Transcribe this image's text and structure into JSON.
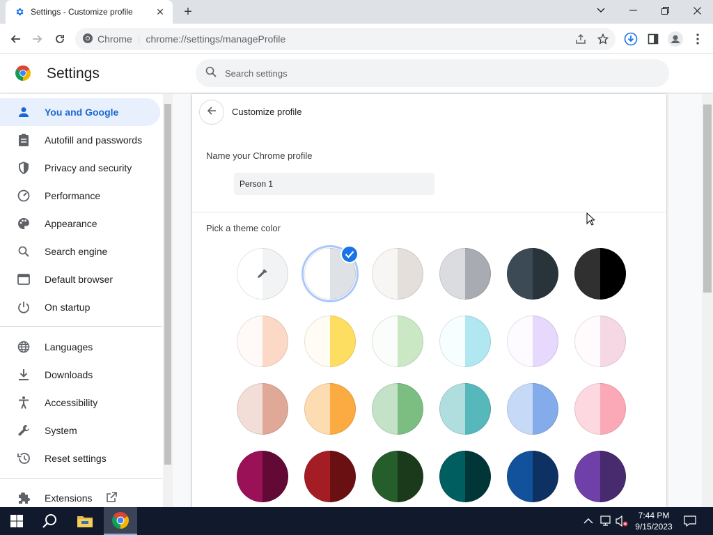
{
  "browser": {
    "tab_title": "Settings - Customize profile",
    "omnibox_site": "Chrome",
    "omnibox_url": "chrome://settings/manageProfile"
  },
  "settings_header": {
    "title": "Settings",
    "search_placeholder": "Search settings"
  },
  "sidebar": {
    "items": [
      {
        "label": "You and Google",
        "icon": "person-icon",
        "active": true
      },
      {
        "label": "Autofill and passwords",
        "icon": "clipboard-icon"
      },
      {
        "label": "Privacy and security",
        "icon": "shield-icon"
      },
      {
        "label": "Performance",
        "icon": "speedometer-icon"
      },
      {
        "label": "Appearance",
        "icon": "palette-icon"
      },
      {
        "label": "Search engine",
        "icon": "search-icon"
      },
      {
        "label": "Default browser",
        "icon": "browser-window-icon"
      },
      {
        "label": "On startup",
        "icon": "power-icon"
      },
      {
        "label": "Languages",
        "icon": "globe-icon"
      },
      {
        "label": "Downloads",
        "icon": "download-icon"
      },
      {
        "label": "Accessibility",
        "icon": "accessibility-icon"
      },
      {
        "label": "System",
        "icon": "wrench-icon"
      },
      {
        "label": "Reset settings",
        "icon": "history-icon"
      },
      {
        "label": "Extensions",
        "icon": "puzzle-icon"
      }
    ]
  },
  "main": {
    "page_title": "Customize profile",
    "name_label": "Name your Chrome profile",
    "name_value": "Person 1",
    "theme_label": "Pick a theme color",
    "selected_theme_index": 1,
    "theme_colors": [
      [
        "#ffffff",
        "#f1f3f4"
      ],
      [
        "#ffffff",
        "#dee1e6"
      ],
      [
        "#f8f6f5",
        "#e4dfdb"
      ],
      [
        "#dadce0",
        "#a9abb3"
      ],
      [
        "#3c4a55",
        "#28343a"
      ],
      [
        "#303030",
        "#000000"
      ],
      [
        "#fffaf7",
        "#fcd8c6"
      ],
      [
        "#fffdf3",
        "#fede60"
      ],
      [
        "#fafdf9",
        "#cbe8c5"
      ],
      [
        "#f7feff",
        "#b0e7f1"
      ],
      [
        "#fdfbff",
        "#e7d8fd"
      ],
      [
        "#fffbfd",
        "#f5d8e4"
      ],
      [
        "#f3ddd7",
        "#e0a897"
      ],
      [
        "#fddcb2",
        "#fcab43"
      ],
      [
        "#c4e2c7",
        "#7cbd82"
      ],
      [
        "#b0dede",
        "#57b8bc"
      ],
      [
        "#c6d9f6",
        "#84abea"
      ],
      [
        "#fdd8e0",
        "#fca9b7"
      ],
      [
        "#9a1158",
        "#620a35"
      ],
      [
        "#a41d24",
        "#6a1013"
      ],
      [
        "#265e2b",
        "#1b3a1b"
      ],
      [
        "#015e60",
        "#003638"
      ],
      [
        "#12529c",
        "#0d3163"
      ],
      [
        "#6e40a8",
        "#472b6e"
      ]
    ]
  },
  "taskbar": {
    "time": "7:44 PM",
    "date": "9/15/2023"
  }
}
